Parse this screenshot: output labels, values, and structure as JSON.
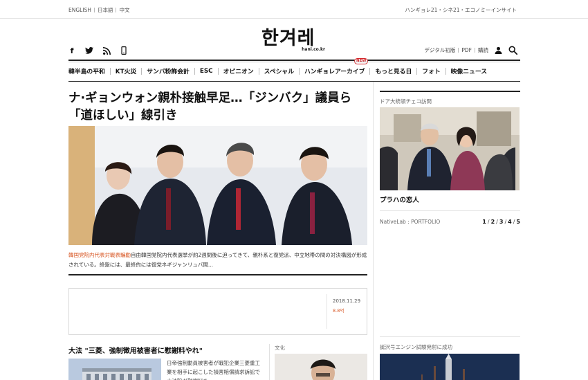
{
  "top_bar": {
    "languages": [
      "ENGLISH",
      "日本語",
      "中文"
    ],
    "sister_sites": "ハンギョレ21・シネ21・エコノミーインサイト"
  },
  "logo": {
    "name": "한겨레",
    "url": "hani.co.kr"
  },
  "social_icons": [
    "facebook-icon",
    "twitter-icon",
    "rss-icon",
    "mobile-icon"
  ],
  "utility": {
    "links": [
      "デジタル初版",
      "PDF",
      "購読"
    ],
    "icons": [
      "user-icon",
      "search-icon"
    ]
  },
  "nav": {
    "items": [
      "韓半島の平和",
      "KT火災",
      "サンバ粉飾会計",
      "ESC",
      "オピニオン",
      "スペシャル",
      "ハンギョレアーカイブ",
      "もっと見る日",
      "フォト",
      "映像ニュース"
    ],
    "new_badge": "NEW"
  },
  "main_story": {
    "headline": "ナ·ギョンウォン親朴接触早足…「ジンバク」議員ら「道ほしい」線引き",
    "kicker": "韓国党院内代表対戦表騙動",
    "summary": "自由韓国党院内代表選挙が約2週間後に迫ってきて、親朴系と復党派、中立地帯の間の対決構図が形成されている。終盤には、最終的には復党ネギジャンリュバ間..."
  },
  "ad_widget": {
    "date": "2018.11.29",
    "change": "8.8억"
  },
  "sub_story": {
    "headline": "大法 \"三菱、強制徴用被害者に慰謝料やれ\"",
    "summary": "日帝強制動員被害者が戦犯企業三菱重工業を相手に起こした損害賠償請求訴訟で大法院が慰謝料を..."
  },
  "culture": {
    "label": "文化"
  },
  "right_column": {
    "label": "ドア大統領チェコ訪問",
    "caption": "プラハの恋人",
    "native_label": "NativeLab : PORTFOLIO",
    "pager": [
      "1",
      "2",
      "3",
      "4",
      "5"
    ],
    "bottom_label": "誕沢号エンジン試験発射に成功"
  },
  "colors": {
    "accent": "#d7531f",
    "badge": "#d3262a",
    "rule": "#222222"
  }
}
